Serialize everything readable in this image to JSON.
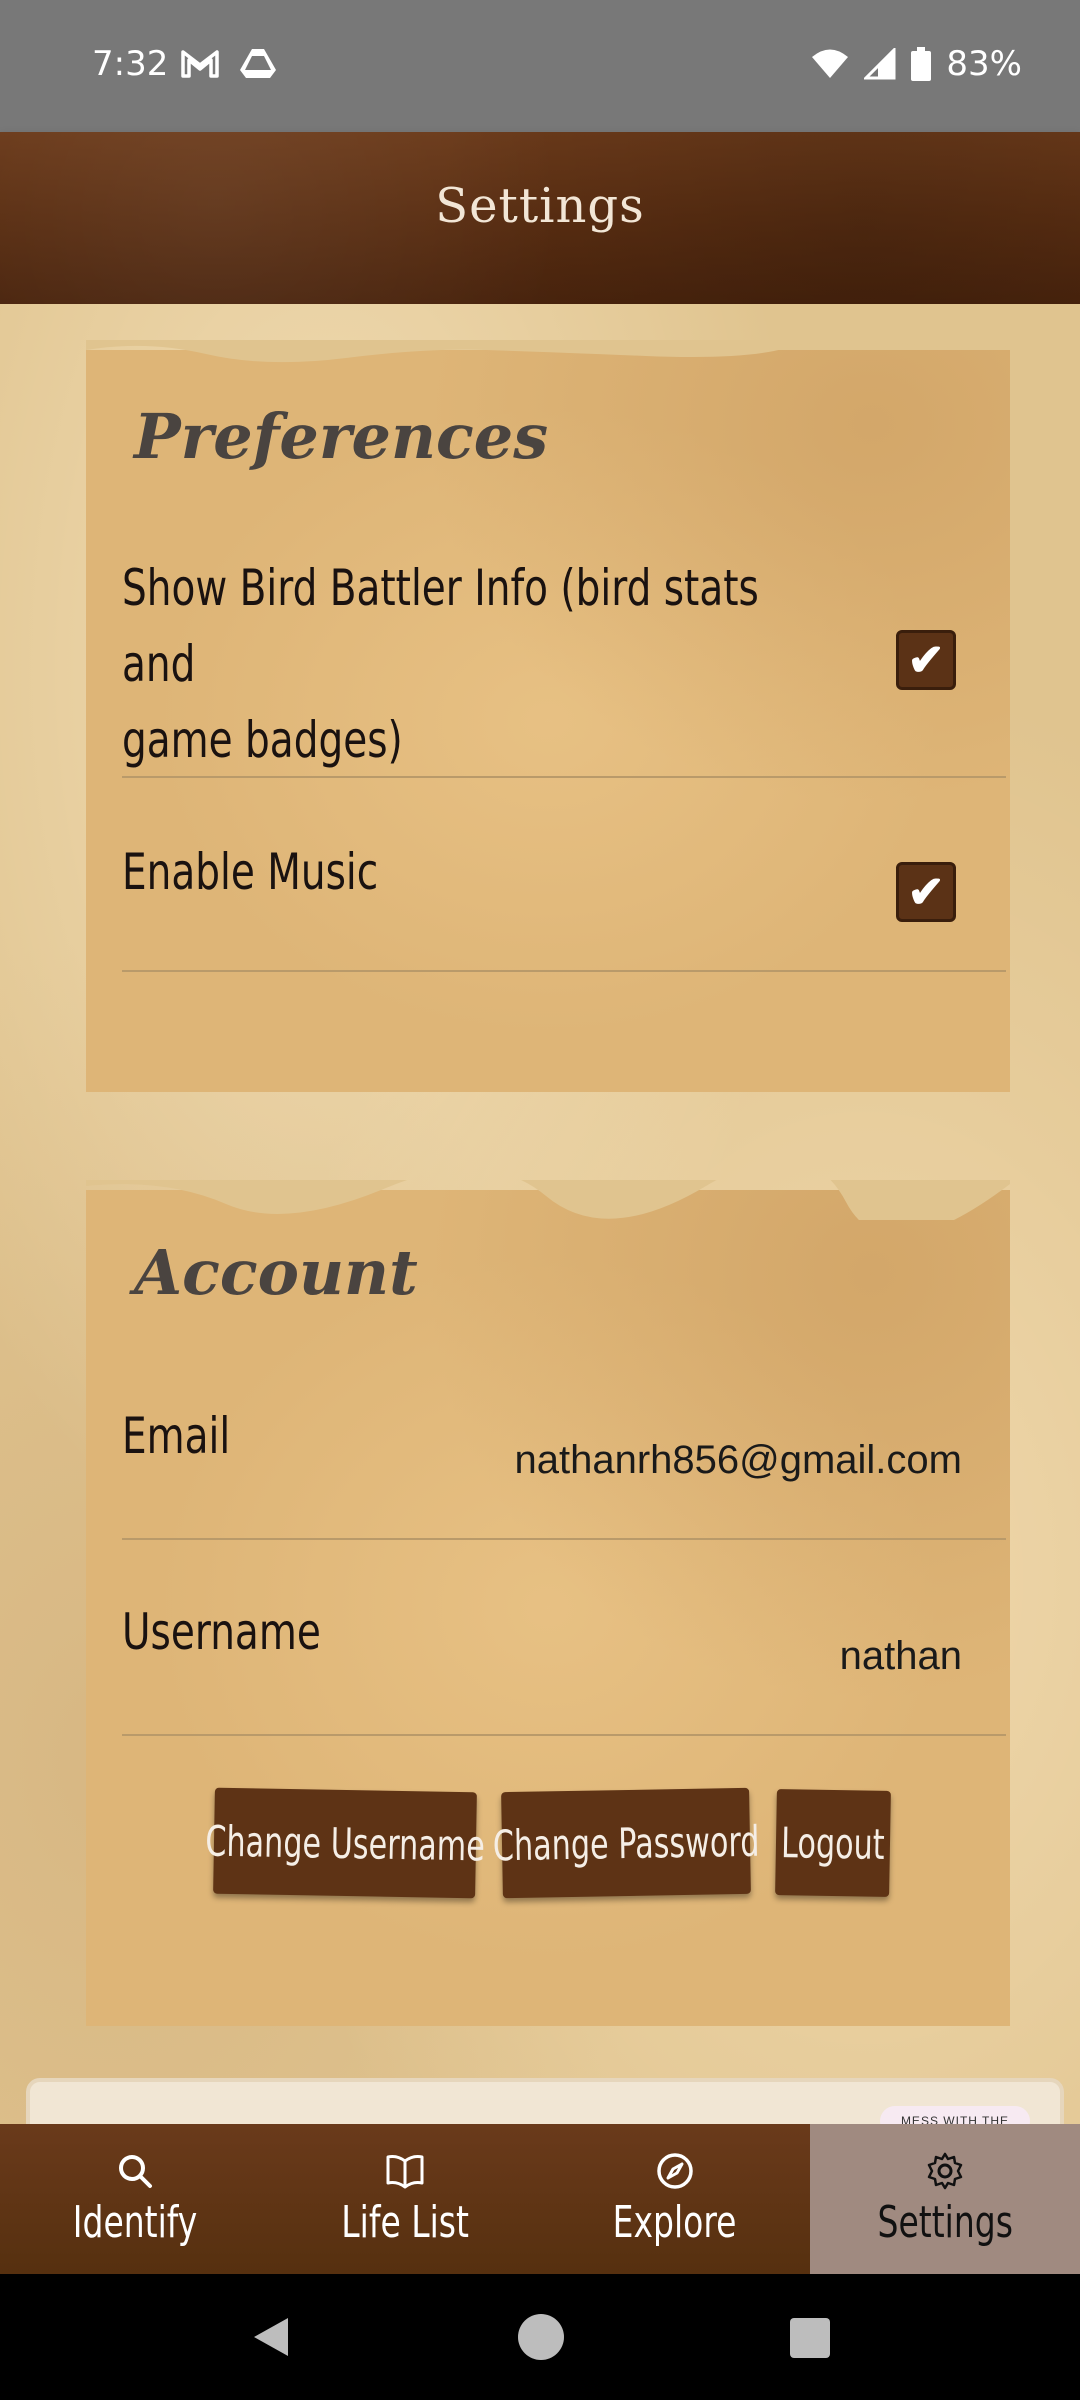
{
  "status_bar": {
    "time": "7:32",
    "left_icons": [
      "gmail-icon",
      "drive-icon"
    ],
    "right_icons": [
      "wifi-icon",
      "signal-icon",
      "battery-icon"
    ],
    "battery": "83%"
  },
  "header": {
    "title": "Settings"
  },
  "preferences": {
    "title": "Preferences",
    "items": [
      {
        "label_line1": "Show Bird Battler Info (bird stats and",
        "label_line2": "game badges)",
        "checked": true
      },
      {
        "label": "Enable Music",
        "checked": true
      }
    ],
    "check_glyph": "✔"
  },
  "account": {
    "title": "Account",
    "email_label": "Email",
    "email_value": "nathanrh856@gmail.com",
    "username_label": "Username",
    "username_value": "nathan",
    "buttons": {
      "change_username": "Change Username",
      "change_password": "Change Password",
      "logout": "Logout"
    }
  },
  "peek_card": {
    "badge_text": "MESS WITH THE HONK"
  },
  "bottom_nav": {
    "items": [
      {
        "label": "Identify",
        "icon": "search-icon"
      },
      {
        "label": "Life List",
        "icon": "book-icon"
      },
      {
        "label": "Explore",
        "icon": "compass-icon"
      },
      {
        "label": "Settings",
        "icon": "gear-icon",
        "active": true
      }
    ]
  },
  "colors": {
    "header_brown": "#5a2e12",
    "card_tan": "#deb577",
    "button_brown": "#5e3315",
    "active_tab": "#a08a80"
  }
}
